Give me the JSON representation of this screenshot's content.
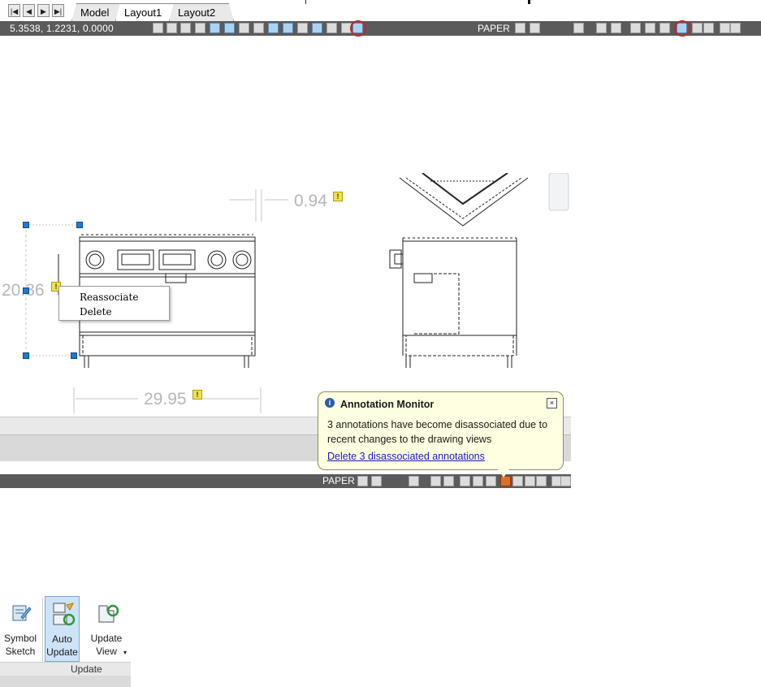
{
  "layout_tabs": {
    "nav_buttons": [
      "first",
      "previous",
      "next",
      "last"
    ],
    "tabs": [
      {
        "label": "Model",
        "active": false
      },
      {
        "label": "Layout1",
        "active": true
      },
      {
        "label": "Layout2",
        "active": false
      }
    ]
  },
  "top_status_bar": {
    "coordinates": "5.3538, 1.2231, 0.0000",
    "paper_label": "PAPER",
    "highlighted_icons": [
      "annotation-monitor-toggle-icon",
      "annotation-monitor-tray-icon"
    ]
  },
  "drawing": {
    "dimensions": [
      {
        "value": "0.94",
        "status": "disassociated"
      },
      {
        "value": "20.36",
        "status": "disassociated"
      },
      {
        "value": "29.95",
        "status": "disassociated"
      }
    ]
  },
  "context_menu": {
    "items": [
      "Reassociate",
      "Delete"
    ]
  },
  "annotation_monitor": {
    "title": "Annotation Monitor",
    "message": "3 annotations have become disassociated due to recent changes to the drawing views",
    "link": "Delete 3 disassociated annotations"
  },
  "bottom_status_bar": {
    "paper_label": "PAPER"
  },
  "ribbon": {
    "buttons": [
      {
        "line1": "Symbol",
        "line2": "Sketch",
        "active": false
      },
      {
        "line1": "Auto",
        "line2": "Update",
        "active": true
      },
      {
        "line1": "Update",
        "line2": "View",
        "active": false
      }
    ],
    "panel_label": "Update"
  },
  "colors": {
    "status_bar": "#5b5b5b",
    "highlight_circle": "#c0282c",
    "balloon_bg": "#ffffe1",
    "link": "#1a1abf",
    "grip": "#1f78d1",
    "dimension_text": "#b3b8bd",
    "warning_badge": "#f1e24b"
  }
}
